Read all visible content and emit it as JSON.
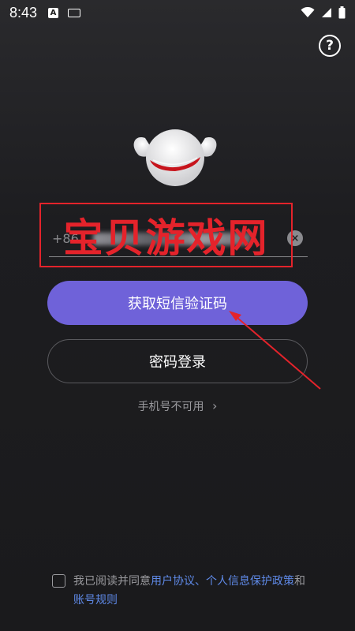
{
  "status_bar": {
    "time": "8:43",
    "icons": [
      "accessibility-icon",
      "keyboard-icon",
      "wifi-icon",
      "signal-icon",
      "battery-icon"
    ]
  },
  "help": {
    "label": "?"
  },
  "login": {
    "country_code": "+86",
    "clear_label": "×",
    "sms_button": "获取短信验证码",
    "password_button": "密码登录",
    "phone_unavailable": "手机号不可用",
    "phone_unavailable_chevron": "›"
  },
  "watermark": {
    "text": "宝贝游戏网"
  },
  "agreement": {
    "prefix": "我已阅读并同意",
    "user_agreement": "用户协议",
    "separator": "、",
    "privacy_policy": "个人信息保护政策",
    "conjunction": "和",
    "account_rules": "账号规则"
  },
  "colors": {
    "primary": "#6f62d9",
    "link": "#5f8ae8",
    "watermark": "#e4232b",
    "background": "#1d1d20"
  }
}
